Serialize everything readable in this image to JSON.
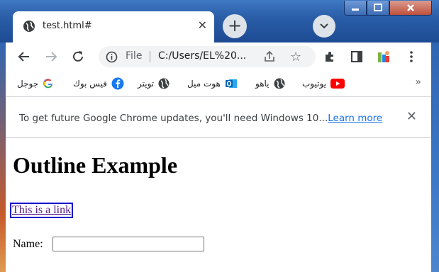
{
  "tab": {
    "title": "test.html#"
  },
  "toolbar": {
    "file_label": "File",
    "url": "C:/Users/EL%20..."
  },
  "bookmarks": [
    {
      "label": "جوجل",
      "icon": "google-icon"
    },
    {
      "label": "فيس بوك",
      "icon": "facebook-icon"
    },
    {
      "label": "تويتر",
      "icon": "globe-icon"
    },
    {
      "label": "هوت ميل",
      "icon": "outlook-icon"
    },
    {
      "label": "ياهو",
      "icon": "globe-icon"
    },
    {
      "label": "يوتيوب",
      "icon": "youtube-icon"
    }
  ],
  "bookmarks_more": "»",
  "infobar": {
    "message": "To get future Google Chrome updates, you'll need Windows 10...",
    "link": "Learn more"
  },
  "page": {
    "heading": "Outline Example",
    "link_text": "This is a link",
    "name_label": "Name:",
    "name_value": ""
  }
}
